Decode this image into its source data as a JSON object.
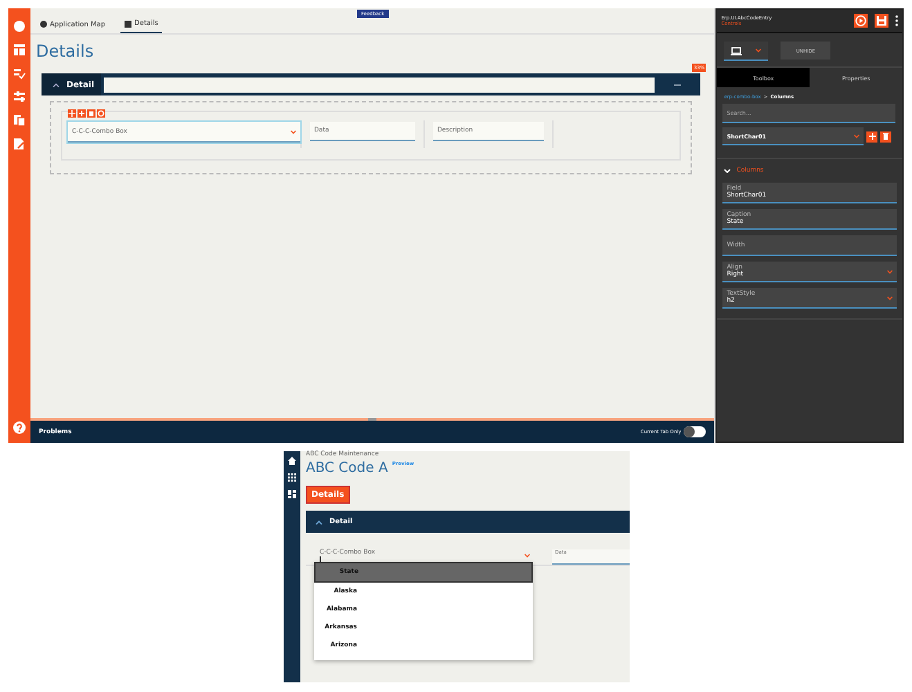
{
  "designer": {
    "tabs": [
      {
        "label": "Application Map",
        "selected": false
      },
      {
        "label": "Details",
        "selected": true
      }
    ],
    "feedback": "Feedback",
    "page_title": "Details",
    "panel": {
      "title": "Detail",
      "expanded": true,
      "badge": "33%"
    },
    "fields": [
      {
        "kind": "combo",
        "label": "C-C-C-Combo Box",
        "selected": true
      },
      {
        "kind": "text",
        "label": "Data",
        "selected": false
      },
      {
        "kind": "text",
        "label": "Description",
        "selected": false
      }
    ],
    "problems": {
      "label": "Problems",
      "toggle_label": "Current Tab Only",
      "on": false
    }
  },
  "properties_panel": {
    "title": "Erp.UI.AbcCodeEntry",
    "subtitle": "Controls",
    "unhide": "UNHIDE",
    "tabs": [
      {
        "label": "Toolbox",
        "selected": true
      },
      {
        "label": "Properties",
        "selected": false
      }
    ],
    "breadcrumb": {
      "link": "erp-combo-box",
      "separator": ">",
      "current": "Columns"
    },
    "search_placeholder": "Search...",
    "column_select": "ShortChar01",
    "section": {
      "title": "Columns",
      "expanded": true
    },
    "props": [
      {
        "kind": "text",
        "label": "Field",
        "value": "ShortChar01"
      },
      {
        "kind": "text",
        "label": "Caption",
        "value": "State"
      },
      {
        "kind": "text",
        "label": "Width"
      },
      {
        "kind": "select",
        "label": "Align",
        "value": "Right"
      },
      {
        "kind": "select",
        "label": "TextStyle",
        "value": "h2"
      }
    ]
  },
  "preview": {
    "breadcrumb": "ABC Code Maintenance",
    "title": "ABC Code A",
    "badge": "Preview",
    "tab": "Details",
    "panel_title": "Detail",
    "combo_label": "C-C-C-Combo Box",
    "data_label": "Data",
    "dropdown": {
      "header": "State",
      "items": [
        "Alaska",
        "Alabama",
        "Arkansas",
        "Arizona"
      ]
    }
  }
}
